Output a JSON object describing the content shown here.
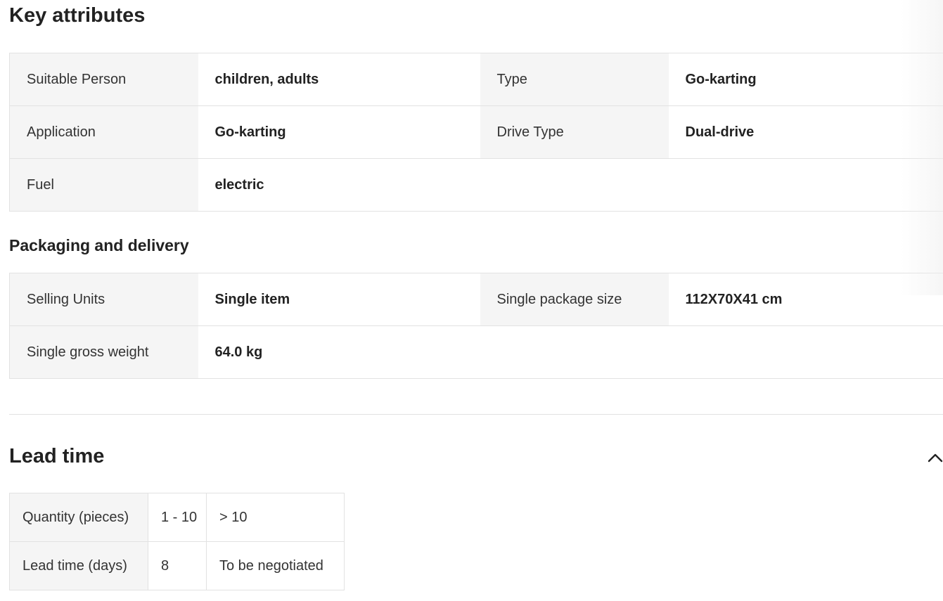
{
  "key_attributes": {
    "title": "Key attributes",
    "rows": [
      [
        {
          "label": "Suitable Person",
          "value": "children, adults"
        },
        {
          "label": "Type",
          "value": "Go-karting"
        }
      ],
      [
        {
          "label": "Application",
          "value": "Go-karting"
        },
        {
          "label": "Drive Type",
          "value": "Dual-drive"
        }
      ],
      [
        {
          "label": "Fuel",
          "value": "electric"
        }
      ]
    ]
  },
  "packaging": {
    "title": "Packaging and delivery",
    "rows": [
      [
        {
          "label": "Selling Units",
          "value": "Single item"
        },
        {
          "label": "Single package size",
          "value": "112X70X41 cm"
        }
      ],
      [
        {
          "label": "Single gross weight",
          "value": "64.0 kg"
        }
      ]
    ]
  },
  "lead_time": {
    "title": "Lead time",
    "toggle_icon": "chevron-up-icon",
    "rows": [
      {
        "label": "Quantity (pieces)",
        "cells": [
          "1 - 10",
          "> 10"
        ]
      },
      {
        "label": "Lead time (days)",
        "cells": [
          "8",
          "To be negotiated"
        ]
      }
    ]
  }
}
